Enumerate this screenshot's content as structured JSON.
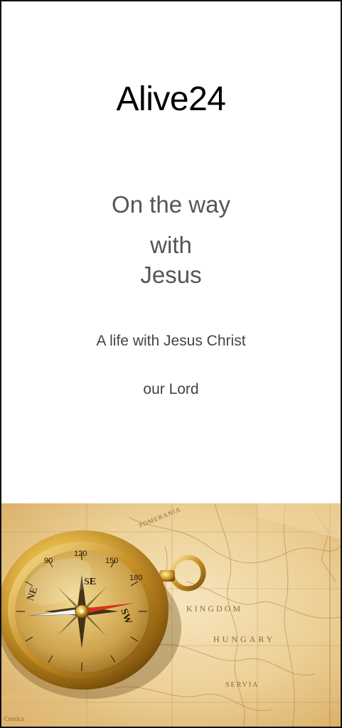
{
  "brand": {
    "title": "Alive24"
  },
  "headline": {
    "line1": "On the way",
    "line2": "with",
    "line3": "Jesus"
  },
  "subtitle": {
    "line1": "A life with Jesus Christ",
    "line2": "our Lord"
  },
  "cover_image": {
    "icon": "compass-on-map",
    "map_labels": [
      "KINGDOM",
      "HUNGARY",
      "SERVIA",
      "POMERANIA",
      "Corsica"
    ],
    "compass_labels": [
      "90",
      "120",
      "150",
      "180",
      "SE",
      "SW",
      "NE"
    ],
    "colors": {
      "map_base": "#e8c98f",
      "map_light": "#f3dfb2",
      "brass": "#c9962a",
      "dial": "#d6b560"
    }
  }
}
